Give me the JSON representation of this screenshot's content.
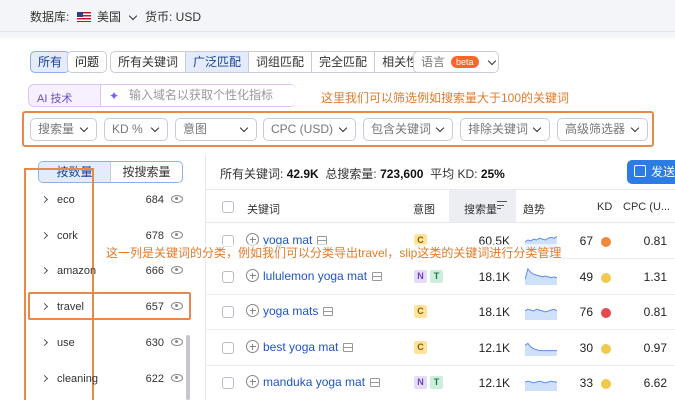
{
  "topbar": {
    "database_label": "数据库:",
    "database_value": "美国",
    "currency": "货币: USD"
  },
  "match_tabs": {
    "all": "所有",
    "questions": "问题",
    "group": [
      "所有关键词",
      "广泛匹配",
      "词组匹配",
      "完全匹配",
      "相关性"
    ],
    "language": "语言",
    "beta": "beta"
  },
  "ai": {
    "label": "AI 技术",
    "placeholder": "输入域名以获取个性化指标"
  },
  "annotations": {
    "filter_note": "这里我们可以筛选例如搜索量大于100的关键词",
    "category_note": "这一列是关键词的分类，例如我们可以分类导出travel，slip这类的关键词进行分类管理"
  },
  "filters": [
    "搜索量",
    "KD %",
    "意图",
    "CPC (USD)",
    "包含关键词",
    "排除关键词",
    "高级筛选器"
  ],
  "sidebar": {
    "toggle": [
      "按数量",
      "按搜索量"
    ],
    "categories": [
      {
        "name": "eco",
        "count": "684"
      },
      {
        "name": "cork",
        "count": "678"
      },
      {
        "name": "amazon",
        "count": "666"
      },
      {
        "name": "travel",
        "count": "657"
      },
      {
        "name": "use",
        "count": "630"
      },
      {
        "name": "cleaning",
        "count": "622"
      }
    ]
  },
  "summary": {
    "all_keywords_label": "所有关键词:",
    "all_keywords_value": "42.9K",
    "total_volume_label": "总搜索量:",
    "total_volume_value": "723,600",
    "avg_kd_label": "平均 KD:",
    "avg_kd_value": "25%",
    "send_label": "发送"
  },
  "table": {
    "headers": {
      "keyword": "关键词",
      "intent": "意图",
      "volume": "搜索量",
      "trend": "趋势",
      "kd": "KD",
      "cpc": "CPC (U..."
    },
    "rows": [
      {
        "keyword": "yoga mat",
        "intent": [
          "C"
        ],
        "volume": "60.5K",
        "kd": "67",
        "kd_color": "#f0883e",
        "cpc": "0.81",
        "trend": [
          0.4,
          0.5,
          0.45,
          0.55,
          0.5,
          0.6,
          0.55,
          0.5,
          0.6,
          0.65,
          0.6,
          0.7
        ]
      },
      {
        "keyword": "lululemon yoga mat",
        "intent": [
          "N",
          "T"
        ],
        "volume": "18.1K",
        "kd": "49",
        "kd_color": "#f2c94c",
        "cpc": "1.31",
        "trend": [
          0.3,
          0.9,
          0.7,
          0.6,
          0.55,
          0.5,
          0.45,
          0.5,
          0.45,
          0.4,
          0.45,
          0.4
        ]
      },
      {
        "keyword": "yoga mats",
        "intent": [
          "C"
        ],
        "volume": "18.1K",
        "kd": "76",
        "kd_color": "#e5484d",
        "cpc": "0.81",
        "trend": [
          0.5,
          0.6,
          0.55,
          0.5,
          0.6,
          0.55,
          0.5,
          0.45,
          0.5,
          0.55,
          0.6,
          0.5
        ]
      },
      {
        "keyword": "best yoga mat",
        "intent": [
          "C"
        ],
        "volume": "12.1K",
        "kd": "30",
        "kd_color": "#f2c94c",
        "cpc": "0.97",
        "trend": [
          0.6,
          0.7,
          0.5,
          0.4,
          0.35,
          0.3,
          0.3,
          0.3,
          0.3,
          0.3,
          0.3,
          0.3
        ]
      },
      {
        "keyword": "manduka yoga mat",
        "intent": [
          "N",
          "T"
        ],
        "volume": "12.1K",
        "kd": "33",
        "kd_color": "#f2c94c",
        "cpc": "6.62",
        "trend": [
          0.5,
          0.55,
          0.5,
          0.45,
          0.5,
          0.55,
          0.5,
          0.45,
          0.5,
          0.55,
          0.5,
          0.5
        ]
      }
    ]
  }
}
